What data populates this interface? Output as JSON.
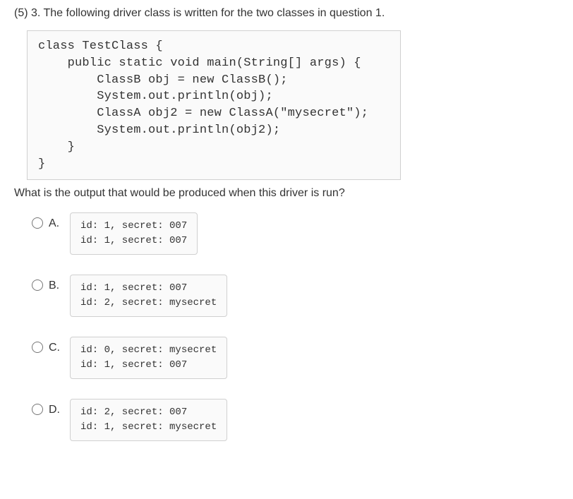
{
  "question": {
    "header": "(5) 3. The following driver class is written for the two classes in question 1.",
    "code": "class TestClass {\n    public static void main(String[] args) {\n        ClassB obj = new ClassB();\n        System.out.println(obj);\n        ClassA obj2 = new ClassA(\"mysecret\");\n        System.out.println(obj2);\n    }\n}",
    "prompt": "What is the output that would be produced when this driver is run?"
  },
  "options": [
    {
      "label": "A.",
      "output": "id: 1, secret: 007\nid: 1, secret: 007"
    },
    {
      "label": "B.",
      "output": "id: 1, secret: 007\nid: 2, secret: mysecret"
    },
    {
      "label": "C.",
      "output": "id: 0, secret: mysecret\nid: 1, secret: 007"
    },
    {
      "label": "D.",
      "output": "id: 2, secret: 007\nid: 1, secret: mysecret"
    }
  ]
}
